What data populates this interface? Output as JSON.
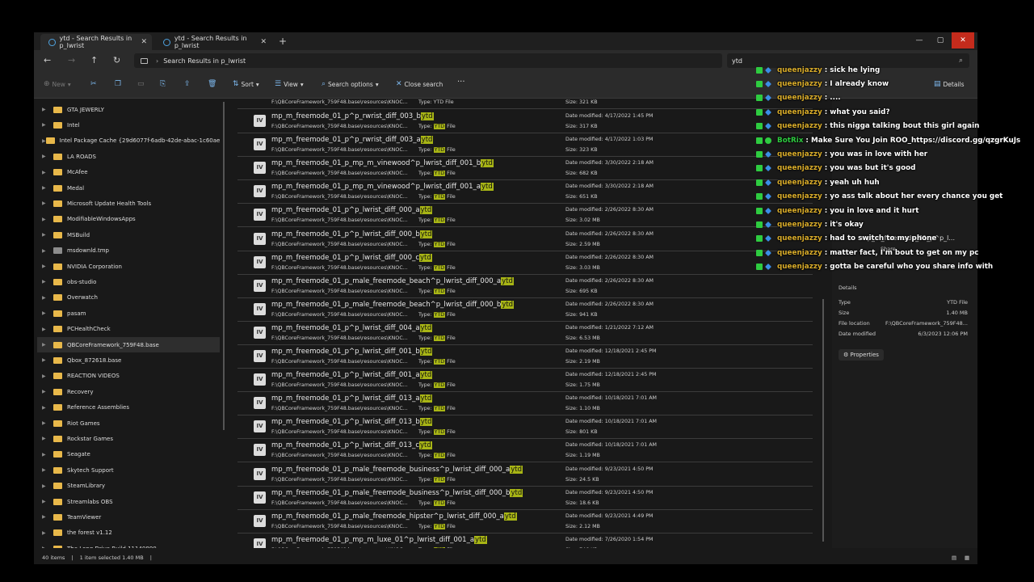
{
  "tabs": [
    {
      "label": "ytd - Search Results in p_lwrist",
      "close": "✕"
    },
    {
      "label": "ytd - Search Results in p_lwrist",
      "close": "✕"
    }
  ],
  "newtab": "+",
  "window_controls": {
    "minimize": "—",
    "maximize": "▢",
    "close": "✕"
  },
  "nav": {
    "back": "←",
    "forward": "→",
    "up": "↑",
    "refresh": "↻"
  },
  "address": {
    "chevron": "›",
    "text": "Search Results in p_lwrist"
  },
  "search": {
    "value": "ytd",
    "icon": "⌕"
  },
  "toolbar": {
    "new": "New",
    "sort": "Sort",
    "view": "View",
    "search_options": "Search options",
    "close_search": "Close search",
    "more": "···",
    "details": "Details"
  },
  "sidebar": [
    {
      "label": "GTA JEWERLY",
      "folder": "yellow"
    },
    {
      "label": "Intel",
      "folder": "yellow"
    },
    {
      "label": "Intel Package Cache {29d6077f-6adb-42de-abac-1c60aeb0e2",
      "folder": "yellow"
    },
    {
      "label": "LA ROADS",
      "folder": "yellow"
    },
    {
      "label": "McAfee",
      "folder": "yellow"
    },
    {
      "label": "Medal",
      "folder": "yellow"
    },
    {
      "label": "Microsoft Update Health Tools",
      "folder": "yellow"
    },
    {
      "label": "ModifiableWindowsApps",
      "folder": "yellow"
    },
    {
      "label": "MSBuild",
      "folder": "yellow"
    },
    {
      "label": "msdownld.tmp",
      "folder": "gray"
    },
    {
      "label": "NVIDIA Corporation",
      "folder": "yellow"
    },
    {
      "label": "obs-studio",
      "folder": "yellow"
    },
    {
      "label": "Overwatch",
      "folder": "yellow"
    },
    {
      "label": "pasam",
      "folder": "yellow"
    },
    {
      "label": "PCHealthCheck",
      "folder": "yellow"
    },
    {
      "label": "QBCoreFramework_759F48.base",
      "folder": "yellow",
      "selected": true
    },
    {
      "label": "Qbox_872618.base",
      "folder": "yellow"
    },
    {
      "label": "REACTION VIDEOS",
      "folder": "yellow"
    },
    {
      "label": "Recovery",
      "folder": "yellow"
    },
    {
      "label": "Reference Assemblies",
      "folder": "yellow"
    },
    {
      "label": "Riot Games",
      "folder": "yellow"
    },
    {
      "label": "Rockstar Games",
      "folder": "yellow"
    },
    {
      "label": "Seagate",
      "folder": "yellow"
    },
    {
      "label": "Skytech Support",
      "folder": "yellow"
    },
    {
      "label": "SteamLibrary",
      "folder": "yellow"
    },
    {
      "label": "Streamlabs OBS",
      "folder": "yellow"
    },
    {
      "label": "TeamViewer",
      "folder": "yellow"
    },
    {
      "label": "the forest v1.12",
      "folder": "yellow"
    },
    {
      "label": "The.Long.Drive.Build.11140890",
      "folder": "yellow"
    }
  ],
  "list": {
    "path": "F:\\QBCoreFramework_759F48.base\\resources\\KNOC...",
    "type_prefix": "Type:",
    "type_hl": "YTD",
    "type_suffix": " File",
    "date_prefix": "Date modified:",
    "size_prefix": "Size:",
    "icon_text": "IV",
    "partial_size": "Size: 321 KB",
    "partial_type": "Type: YTD File",
    "partial_path": "F:\\QBCoreFramework_759F48.base\\resources\\KNOC...",
    "files": [
      {
        "name": "mp_m_freemode_01_p^p_rwrist_diff_003_b",
        "ext": "ytd",
        "date": "4/17/2022 1:45 PM",
        "size": "317 KB"
      },
      {
        "name": "mp_m_freemode_01_p^p_rwrist_diff_003_a",
        "ext": "ytd",
        "date": "4/17/2022 1:03 PM",
        "size": "323 KB"
      },
      {
        "name": "mp_m_freemode_01_p_mp_m_vinewood^p_lwrist_diff_001_b",
        "ext": "ytd",
        "date": "3/30/2022 2:18 AM",
        "size": "682 KB"
      },
      {
        "name": "mp_m_freemode_01_p_mp_m_vinewood^p_lwrist_diff_001_a",
        "ext": "ytd",
        "date": "3/30/2022 2:18 AM",
        "size": "651 KB"
      },
      {
        "name": "mp_m_freemode_01_p^p_lwrist_diff_000_a",
        "ext": "ytd",
        "date": "2/26/2022 8:30 AM",
        "size": "3.02 MB"
      },
      {
        "name": "mp_m_freemode_01_p^p_lwrist_diff_000_b",
        "ext": "ytd",
        "date": "2/26/2022 8:30 AM",
        "size": "2.59 MB"
      },
      {
        "name": "mp_m_freemode_01_p^p_lwrist_diff_000_c",
        "ext": "ytd",
        "date": "2/26/2022 8:30 AM",
        "size": "3.03 MB"
      },
      {
        "name": "mp_m_freemode_01_p_male_freemode_beach^p_lwrist_diff_000_a",
        "ext": "ytd",
        "date": "2/26/2022 8:30 AM",
        "size": "695 KB"
      },
      {
        "name": "mp_m_freemode_01_p_male_freemode_beach^p_lwrist_diff_000_b",
        "ext": "ytd",
        "date": "2/26/2022 8:30 AM",
        "size": "941 KB"
      },
      {
        "name": "mp_m_freemode_01_p^p_lwrist_diff_004_a",
        "ext": "ytd",
        "date": "1/21/2022 7:12 AM",
        "size": "6.53 MB"
      },
      {
        "name": "mp_m_freemode_01_p^p_lwrist_diff_001_b",
        "ext": "ytd",
        "date": "12/18/2021 2:45 PM",
        "size": "2.19 MB"
      },
      {
        "name": "mp_m_freemode_01_p^p_lwrist_diff_001_a",
        "ext": "ytd",
        "date": "12/18/2021 2:45 PM",
        "size": "1.75 MB"
      },
      {
        "name": "mp_m_freemode_01_p^p_lwrist_diff_013_a",
        "ext": "ytd",
        "date": "10/18/2021 7:01 AM",
        "size": "1.10 MB"
      },
      {
        "name": "mp_m_freemode_01_p^p_lwrist_diff_013_b",
        "ext": "ytd",
        "date": "10/18/2021 7:01 AM",
        "size": "801 KB"
      },
      {
        "name": "mp_m_freemode_01_p^p_lwrist_diff_013_c",
        "ext": "ytd",
        "date": "10/18/2021 7:01 AM",
        "size": "1.19 MB"
      },
      {
        "name": "mp_m_freemode_01_p_male_freemode_business^p_lwrist_diff_000_a",
        "ext": "ytd",
        "date": "9/23/2021 4:50 PM",
        "size": "24.5 KB"
      },
      {
        "name": "mp_m_freemode_01_p_male_freemode_business^p_lwrist_diff_000_b",
        "ext": "ytd",
        "date": "9/23/2021 4:50 PM",
        "size": "18.6 KB"
      },
      {
        "name": "mp_m_freemode_01_p_male_freemode_hipster^p_lwrist_diff_000_a",
        "ext": "ytd",
        "date": "9/23/2021 4:49 PM",
        "size": "2.12 MB"
      },
      {
        "name": "mp_m_freemode_01_p_mp_m_luxe_01^p_lwrist_diff_001_a",
        "ext": "ytd",
        "date": "7/26/2020 1:54 PM",
        "size": "746 KB"
      }
    ]
  },
  "details_pane": {
    "title": "mp_m_freemode_01_p^p_l...",
    "share": "Share",
    "heading": "Details",
    "rows": [
      {
        "label": "Type",
        "value": "YTD File"
      },
      {
        "label": "Size",
        "value": "1.40 MB"
      },
      {
        "label": "File location",
        "value": "F:\\QBCoreFramework_759F48..."
      },
      {
        "label": "Date modified",
        "value": "6/3/2023 12:06 PM"
      }
    ],
    "properties": "Properties"
  },
  "status": {
    "items": "40 items",
    "selected": "1 item selected  1.40 MB"
  },
  "chat": {
    "colors": {
      "user": "#d9ac2a",
      "badge_green": "#2ecc40",
      "badge_blue": "#3a8ee6"
    },
    "messages": [
      {
        "user": "queenjazzy",
        "text": ": sick he lying"
      },
      {
        "user": "queenjazzy",
        "text": ": I already know"
      },
      {
        "user": "queenjazzy",
        "text": ": ...."
      },
      {
        "user": "queenjazzy",
        "text": ": what you said?"
      },
      {
        "user": "queenjazzy",
        "text": ": this nigga talking bout this girl again"
      },
      {
        "user": "BotRix",
        "text": ": Make Sure You Join ROO_https://discord.gg/qzgrKuJs",
        "bot": true
      },
      {
        "user": "queenjazzy",
        "text": ": you was in love with her"
      },
      {
        "user": "queenjazzy",
        "text": ": you was but it's good"
      },
      {
        "user": "queenjazzy",
        "text": ": yeah uh huh"
      },
      {
        "user": "queenjazzy",
        "text": ": yo ass talk about her every chance you get"
      },
      {
        "user": "queenjazzy",
        "text": ": you in love and it hurt"
      },
      {
        "user": "queenjazzy",
        "text": ": it's okay"
      },
      {
        "user": "queenjazzy",
        "text": ": had to switch to my phone"
      },
      {
        "user": "queenjazzy",
        "text": ": matter fact, I'm bout to get on my pc"
      },
      {
        "user": "queenjazzy",
        "text": ": gotta be careful who you share info with"
      }
    ]
  }
}
